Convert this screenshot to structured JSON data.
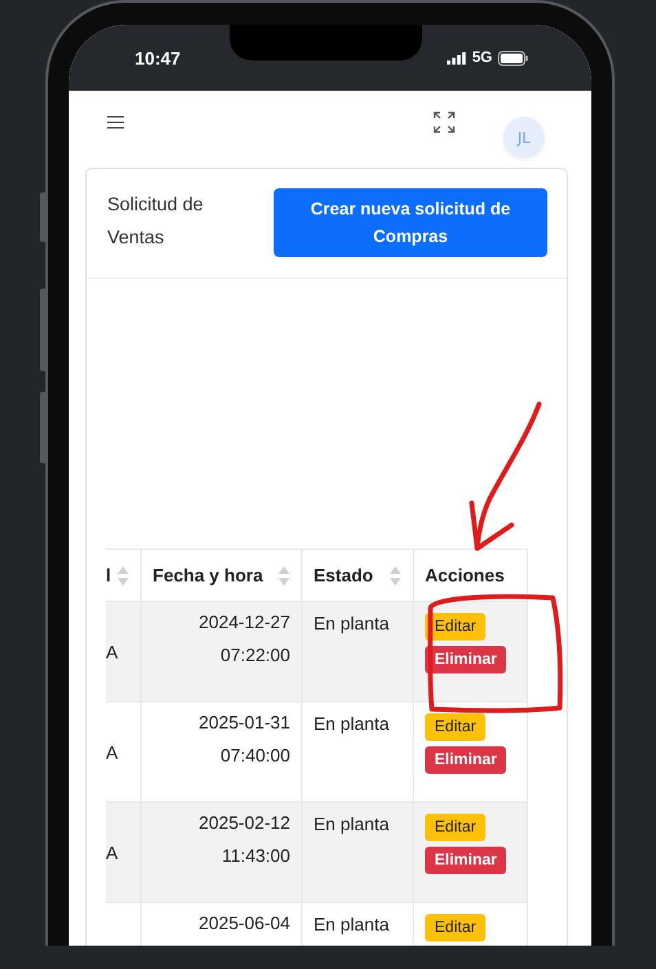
{
  "status_bar": {
    "time": "10:47",
    "network": "5G"
  },
  "header": {
    "avatar": "JL"
  },
  "card": {
    "title": "Solicitud de Ventas",
    "create_button": "Crear nueva solicitud de Compras"
  },
  "table": {
    "columns": [
      {
        "label": "l",
        "sortable": true
      },
      {
        "label": "Fecha y hora",
        "sortable": true
      },
      {
        "label": "Estado",
        "sortable": true
      },
      {
        "label": "Acciones",
        "sortable": false
      }
    ],
    "rows": [
      {
        "column_1": "A",
        "datetime": "2024-12-27 07:22:00",
        "status": "En planta",
        "actions": [
          {
            "kind": "edit",
            "label": "Editar"
          },
          {
            "kind": "delete",
            "label": "Eliminar"
          }
        ]
      },
      {
        "column_1": "A",
        "datetime": "2025-01-31 07:40:00",
        "status": "En planta",
        "actions": [
          {
            "kind": "edit",
            "label": "Editar"
          },
          {
            "kind": "delete",
            "label": "Eliminar"
          }
        ]
      },
      {
        "column_1": "A",
        "datetime": "2025-02-12 11:43:00",
        "status": "En planta",
        "actions": [
          {
            "kind": "edit",
            "label": "Editar"
          },
          {
            "kind": "delete",
            "label": "Eliminar"
          }
        ]
      },
      {
        "datetime": "2025-06-04",
        "status": "En planta",
        "actions": [
          {
            "kind": "edit",
            "label": "Editar"
          }
        ]
      }
    ]
  }
}
